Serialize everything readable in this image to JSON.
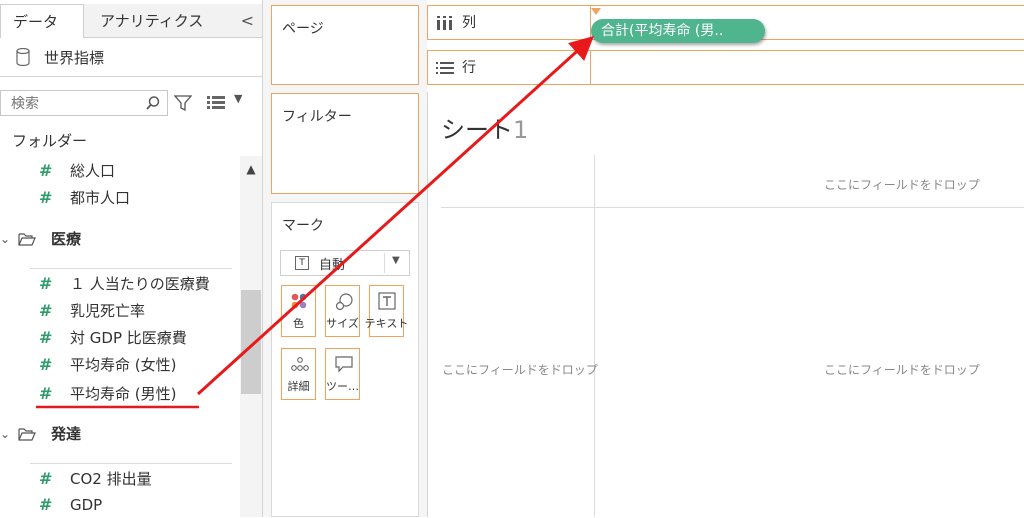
{
  "data_pane": {
    "tabs": [
      {
        "label": "データ"
      },
      {
        "label": "アナリティクス"
      }
    ],
    "collapse_glyph": "<",
    "datasource": {
      "label": "世界指標",
      "icon": "database-icon"
    },
    "search": {
      "placeholder": "検索",
      "value": ""
    },
    "folder_heading": "フォルダー",
    "groups": [
      {
        "name": "",
        "fields": [
          "総人口",
          "都市人口"
        ]
      },
      {
        "name": "医療",
        "fields": [
          "１ 人当たりの医療費",
          "乳児死亡率",
          "対 GDP 比医療費",
          "平均寿命 (女性)",
          "平均寿命 (男性)"
        ]
      },
      {
        "name": "発達",
        "fields": [
          "CO2 排出量",
          "GDP"
        ]
      }
    ],
    "field_type_glyph": "#",
    "colors": {
      "measure": "#2e9c6c",
      "accent": "#f0a35e"
    }
  },
  "cards": {
    "pages": "ページ",
    "filters": "フィルター",
    "marks": {
      "title": "マーク",
      "type_label": "自動",
      "type_icon_glyph": "T",
      "buttons": [
        {
          "label": "色",
          "icon": "color-icon"
        },
        {
          "label": "サイズ",
          "icon": "size-icon"
        },
        {
          "label": "テキスト",
          "icon": "text-icon"
        },
        {
          "label": "詳細",
          "icon": "detail-icon"
        },
        {
          "label": "ツー…",
          "icon": "tooltip-icon"
        }
      ]
    }
  },
  "shelves": {
    "columns": {
      "label": "列",
      "pill": "合計(平均寿命 (男..",
      "pill_color": "#4fb58f"
    },
    "rows": {
      "label": "行"
    }
  },
  "sheet": {
    "title": "シート",
    "title_number": "1",
    "drop_hint": "ここにフィールドをドロップ"
  },
  "annotation": {
    "color": "#e8191b"
  }
}
